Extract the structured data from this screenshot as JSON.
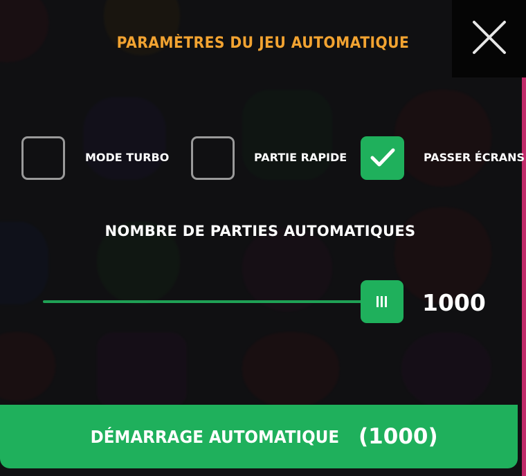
{
  "dialog": {
    "title": "PARAMÈTRES DU JEU AUTOMATIQUE",
    "close_icon": "close-x-icon"
  },
  "options": [
    {
      "label": "MODE TURBO",
      "checked": false
    },
    {
      "label": "PARTIE RAPIDE",
      "checked": false
    },
    {
      "label": "PASSER ÉCRANS",
      "checked": true
    }
  ],
  "rounds": {
    "label": "NOMBRE DE PARTIES AUTOMATIQUES",
    "value": "1000",
    "slider_fraction": 1.0
  },
  "start_button": {
    "label": "DÉMARRAGE AUTOMATIQUE",
    "count": "(1000)"
  },
  "colors": {
    "accent_green": "#1fb05c",
    "title_orange": "#f2a331",
    "background": "#101012"
  }
}
